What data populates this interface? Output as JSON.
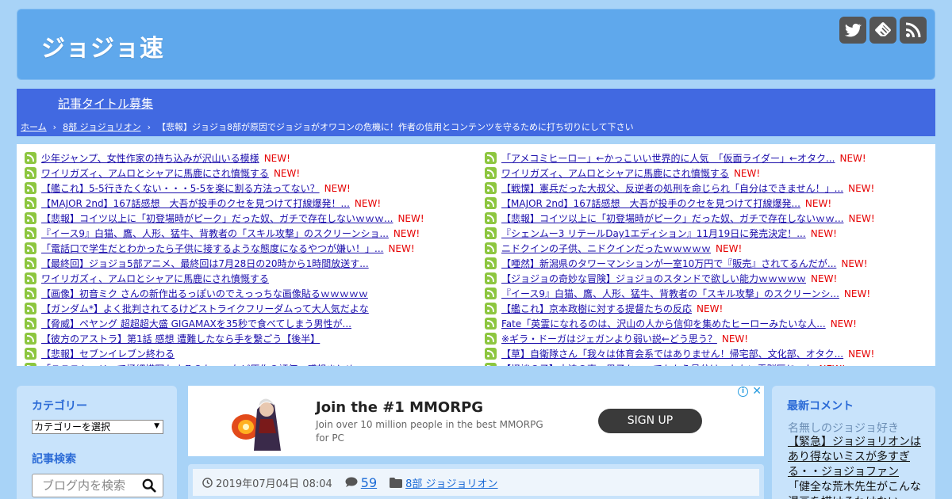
{
  "header": {
    "site_title": "ジョジョ速"
  },
  "social": {
    "icons": [
      "twitter-icon",
      "feedly-icon",
      "rss-icon"
    ]
  },
  "nav": {
    "recruit_link": "記事タイトル募集"
  },
  "breadcrumb": {
    "home": "ホーム",
    "sep": "›",
    "category": "8部 ジョジョリオン",
    "current": "【悲報】ジョジョ8部が原因でジョジョがオワコンの危機に！作者の信用とコンテンツを守るために打ち切りにして下さい"
  },
  "feed": {
    "new_label": "NEW!",
    "left": [
      {
        "title": "少年ジャンプ、女性作家の持ち込みが沢山いる模様",
        "is_new": true
      },
      {
        "title": "ワイリガズィ、アムロとシャアに馬鹿にされ憤慨する",
        "is_new": true
      },
      {
        "title": "【艦これ】5-5行きたくない・・・5-5を楽に割る方法ってない？",
        "is_new": true
      },
      {
        "title": "【MAJOR 2nd】167話感想　大吾が投手のクセを見つけて打線爆発！...",
        "is_new": true
      },
      {
        "title": "【悲報】コイツ以上に「初登場時がピーク」だった奴、ガチで存在しないｗｗｗ...",
        "is_new": true
      },
      {
        "title": "『イース9』白猫、鷹、人形、猛牛、背教者の「スキル攻撃」のスクリーンショ...",
        "is_new": true
      },
      {
        "title": "「電話口で学生だとわかったら子供に接するような態度になるやつが嫌い！」...",
        "is_new": true
      },
      {
        "title": "【最終回】ジョジョ5部アニメ、最終回は7月28日の20時から1時間放送す...",
        "is_new": false
      },
      {
        "title": "ワイリガズィ、アムロとシャアに馬鹿にされ憤慨する",
        "is_new": false
      },
      {
        "title": "【画像】初音ミク さんの新作出るっぽいのでえっっちな画像貼るｗｗｗｗｗ",
        "is_new": false
      },
      {
        "title": "【ガンダム*】よく批判されてるけどストライクフリーダムって大人気だよな",
        "is_new": false
      },
      {
        "title": "【脅威】ペヤング 超超超大盛 GIGAMAXを35秒で食べてしまう男性が...",
        "is_new": false
      },
      {
        "title": "【彼方のアストラ】第1話 感想 遭難したなら手を繋ごう【後半】",
        "is_new": false
      },
      {
        "title": "【悲報】セブンイレブン終わる",
        "is_new": false
      },
      {
        "title": "「ここストーリーで極細描写もするのかー」など原作の評価・感想まとめ",
        "is_new": false
      }
    ],
    "right": [
      {
        "title": "「アメコミヒーロー」←かっこいい世界的に人気　「仮面ライダー」←オタク...",
        "is_new": true
      },
      {
        "title": "ワイリガズィ、アムロとシャアに馬鹿にされ憤慨する",
        "is_new": true
      },
      {
        "title": "【戦慄】憲兵だった大叔父、反逆者の処刑を命じられ「自分はできません！」...",
        "is_new": true
      },
      {
        "title": "【MAJOR 2nd】167話感想　大吾が投手のクセを見つけて打線爆発...",
        "is_new": true
      },
      {
        "title": "【悲報】コイツ以上に「初登場時がピーク」だった奴、ガチで存在しないｗｗ...",
        "is_new": true
      },
      {
        "title": "『シェンムー3 リテールDay1エディション』11月19日に発売決定！...",
        "is_new": true
      },
      {
        "title": "ニドクインの子供、ニドクインだったｗｗｗｗｗ",
        "is_new": true
      },
      {
        "title": "【唖然】新潟県のタワーマンションが一室10万円で『販売』されてるんだが...",
        "is_new": true
      },
      {
        "title": "【ジョジョの奇妙な冒険】ジョジョのスタンドで欲しい能力ｗｗｗｗｗ",
        "is_new": true
      },
      {
        "title": "『イース9』白猫、鷹、人形、猛牛、背教者の「スキル攻撃」のスクリーンシ...",
        "is_new": true
      },
      {
        "title": "【艦これ】京本政樹に対する提督たちの反応",
        "is_new": true
      },
      {
        "title": "Fate「英霊になれるのは、沢山の人から信仰を集めたヒーローみたいな人...",
        "is_new": true
      },
      {
        "title": "※ギラ・ドーガはジェガンより弱い説←どう思う？",
        "is_new": true
      },
      {
        "title": "【草】自衛隊さん「我々は体育会系ではありません！帰宅部、文化部、オタク...",
        "is_new": true
      },
      {
        "title": "【怪談の子】大迫の声、男子か...ってかもう見分けつかない電脳区じゃね",
        "is_new": true
      }
    ]
  },
  "sidebar_left": {
    "category_heading": "カテゴリー",
    "category_select_value": "カテゴリーを選択",
    "search_heading": "記事検索",
    "search_placeholder": "ブログ内を検索"
  },
  "ad": {
    "title": "Join the #1 MMORPG",
    "description": "Join over 10 million people in the best MMORPG for PC",
    "cta": "SIGN UP",
    "info_glyph": "i",
    "close_glyph": "✕"
  },
  "post_meta": {
    "datetime": "2019年07月04日 08:04",
    "comment_count": "59",
    "category": "8部 ジョジョリオン"
  },
  "sidebar_right": {
    "heading": "最新コメント",
    "commenter": "名無しのジョジョ好き",
    "comment_link": "【緊急】ジョジョリオンはあり得ないミスが多すぎる・・ジョジョファン",
    "comment_text": "「健全な荒木先生がこんな漫画を描けるわけない」"
  },
  "colors": {
    "page_bg": "#a8d3f7",
    "header_bg": "#5fa8ec",
    "nav_bg": "#4169e1",
    "rss_green": "#8dc63f",
    "new_red": "#e60000",
    "link_blue": "#1a0dab"
  }
}
